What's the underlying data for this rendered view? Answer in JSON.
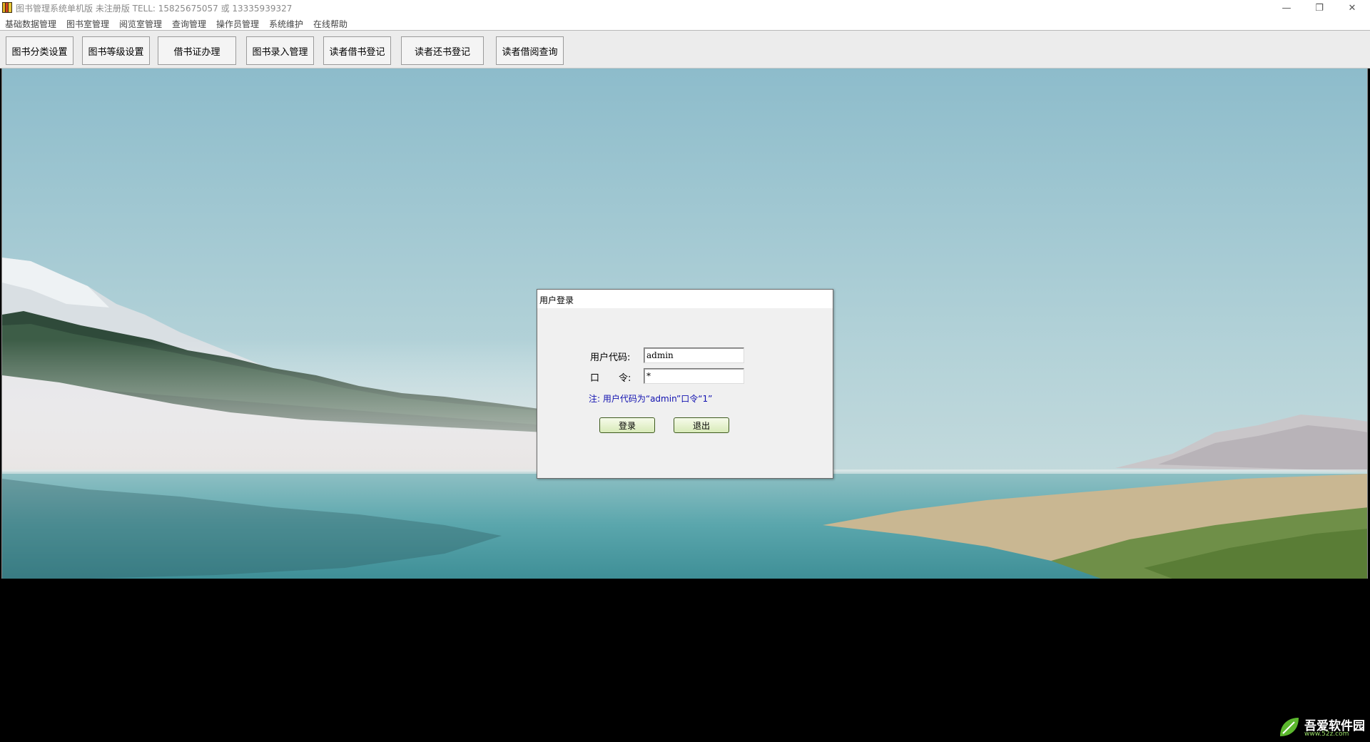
{
  "window": {
    "title": "图书管理系统单机版 未注册版 TELL: 15825675057 或 13335939327",
    "controls": {
      "minimize": "—",
      "restore": "❐",
      "close": "✕"
    }
  },
  "menu": {
    "items": [
      "基础数据管理",
      "图书室管理",
      "阅览室管理",
      "查询管理",
      "操作员管理",
      "系统维护",
      "在线帮助"
    ]
  },
  "toolbar": {
    "buttons": [
      "图书分类设置",
      "图书等级设置",
      "借书证办理",
      "图书录入管理",
      "读者借书登记",
      "读者还书登记",
      "读者借阅查询"
    ]
  },
  "login_dialog": {
    "title": "用户登录",
    "user_label": "用户代码:",
    "user_value": "admin",
    "password_label_1": "口",
    "password_label_2": "令:",
    "password_value": "*",
    "note": "注: 用户代码为“admin”口令“1”",
    "login_button": "登录",
    "exit_button": "退出"
  },
  "watermark": {
    "text": "吾爱软件园",
    "sub": "www.52z.com"
  }
}
